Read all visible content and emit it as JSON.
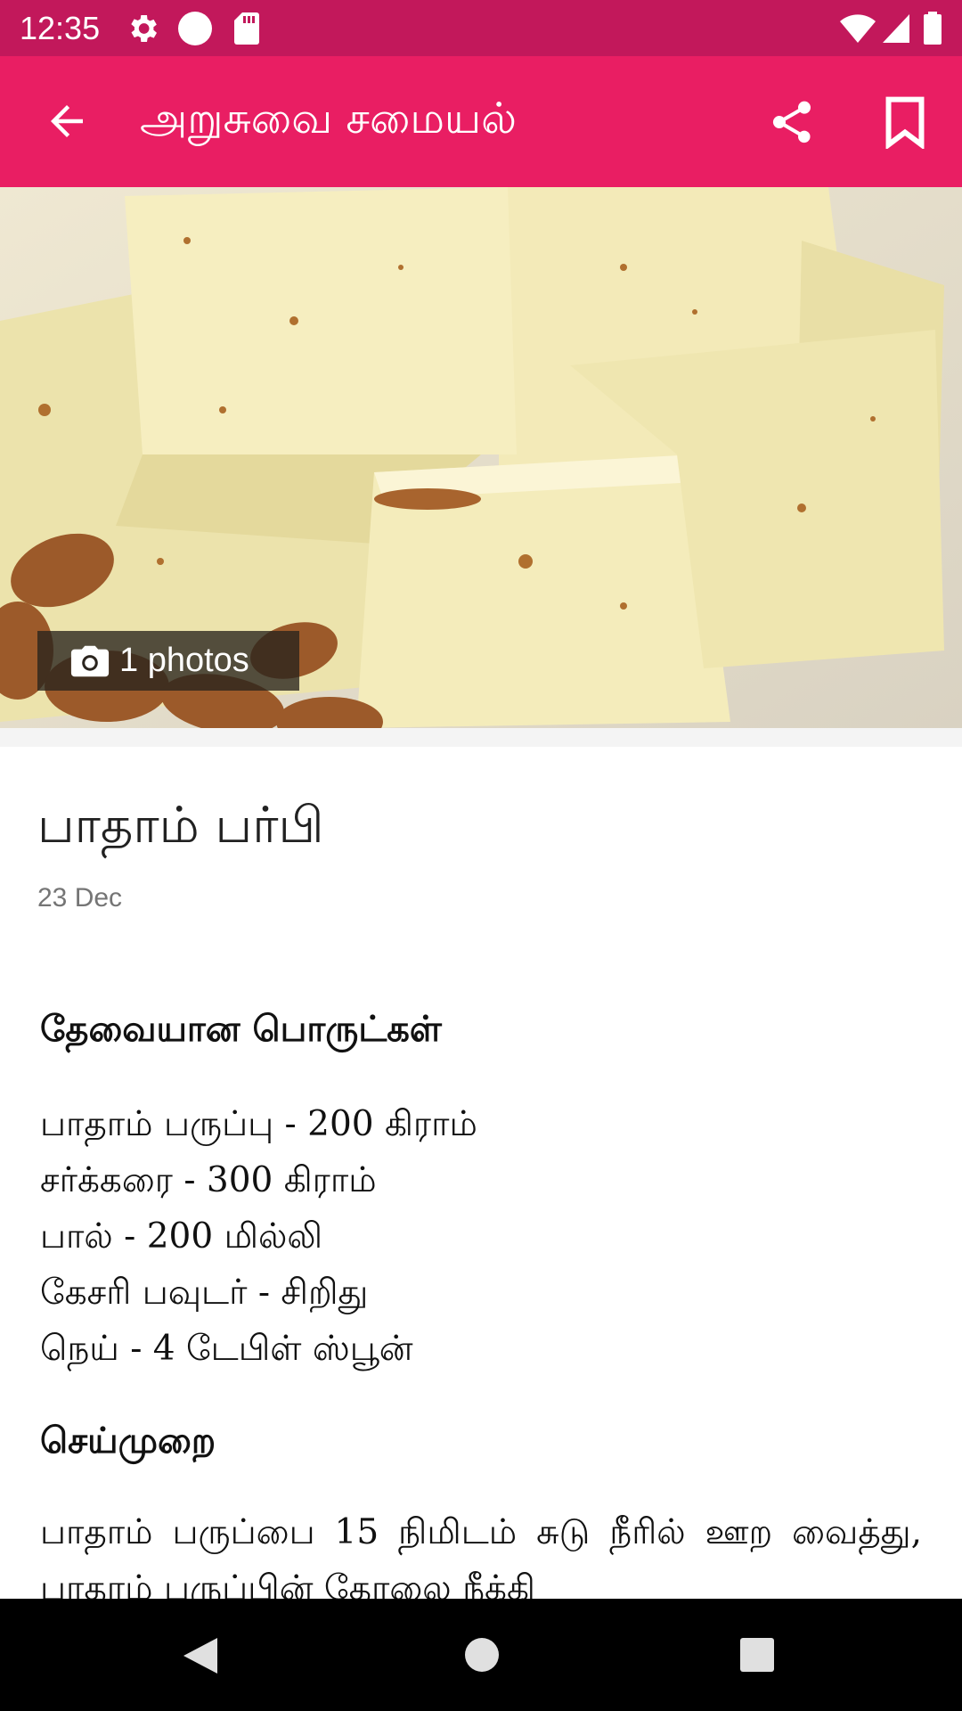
{
  "status_bar": {
    "time": "12:35",
    "left_icons": [
      "settings-icon",
      "circle-icon",
      "sd-card-icon"
    ],
    "right_icons": [
      "wifi-icon",
      "signal-icon",
      "battery-icon"
    ],
    "color": "#c2185b"
  },
  "app_bar": {
    "title": "அறுசுவை சமையல்",
    "color": "#e91e63",
    "icons": [
      "back-arrow-icon",
      "share-icon",
      "bookmark-icon"
    ]
  },
  "hero": {
    "photos_label": "1 photos",
    "photos_icon": "camera-icon"
  },
  "post": {
    "title": "பாதாம் பர்பி",
    "date": "23 Dec"
  },
  "ingredients": {
    "heading": "தேவையான பொருட்கள்",
    "items": [
      "பாதாம் பருப்பு - 200 கிராம்",
      "சர்க்கரை - 300 கிராம்",
      "பால் - 200 மில்லி",
      "கேசரி பவுடர் - சிறிது",
      "நெய் - 4 டேபிள் ஸ்பூன்"
    ]
  },
  "method": {
    "heading": "செய்முறை",
    "text": "பாதாம் பருப்பை 15 நிமிடம் சுடு நீரில் ஊற வைத்து, பாதாம் பருப்பின் தோலை நீக்கி"
  },
  "nav_bar": {
    "icons": [
      "back-triangle-icon",
      "home-circle-icon",
      "recents-square-icon"
    ]
  }
}
